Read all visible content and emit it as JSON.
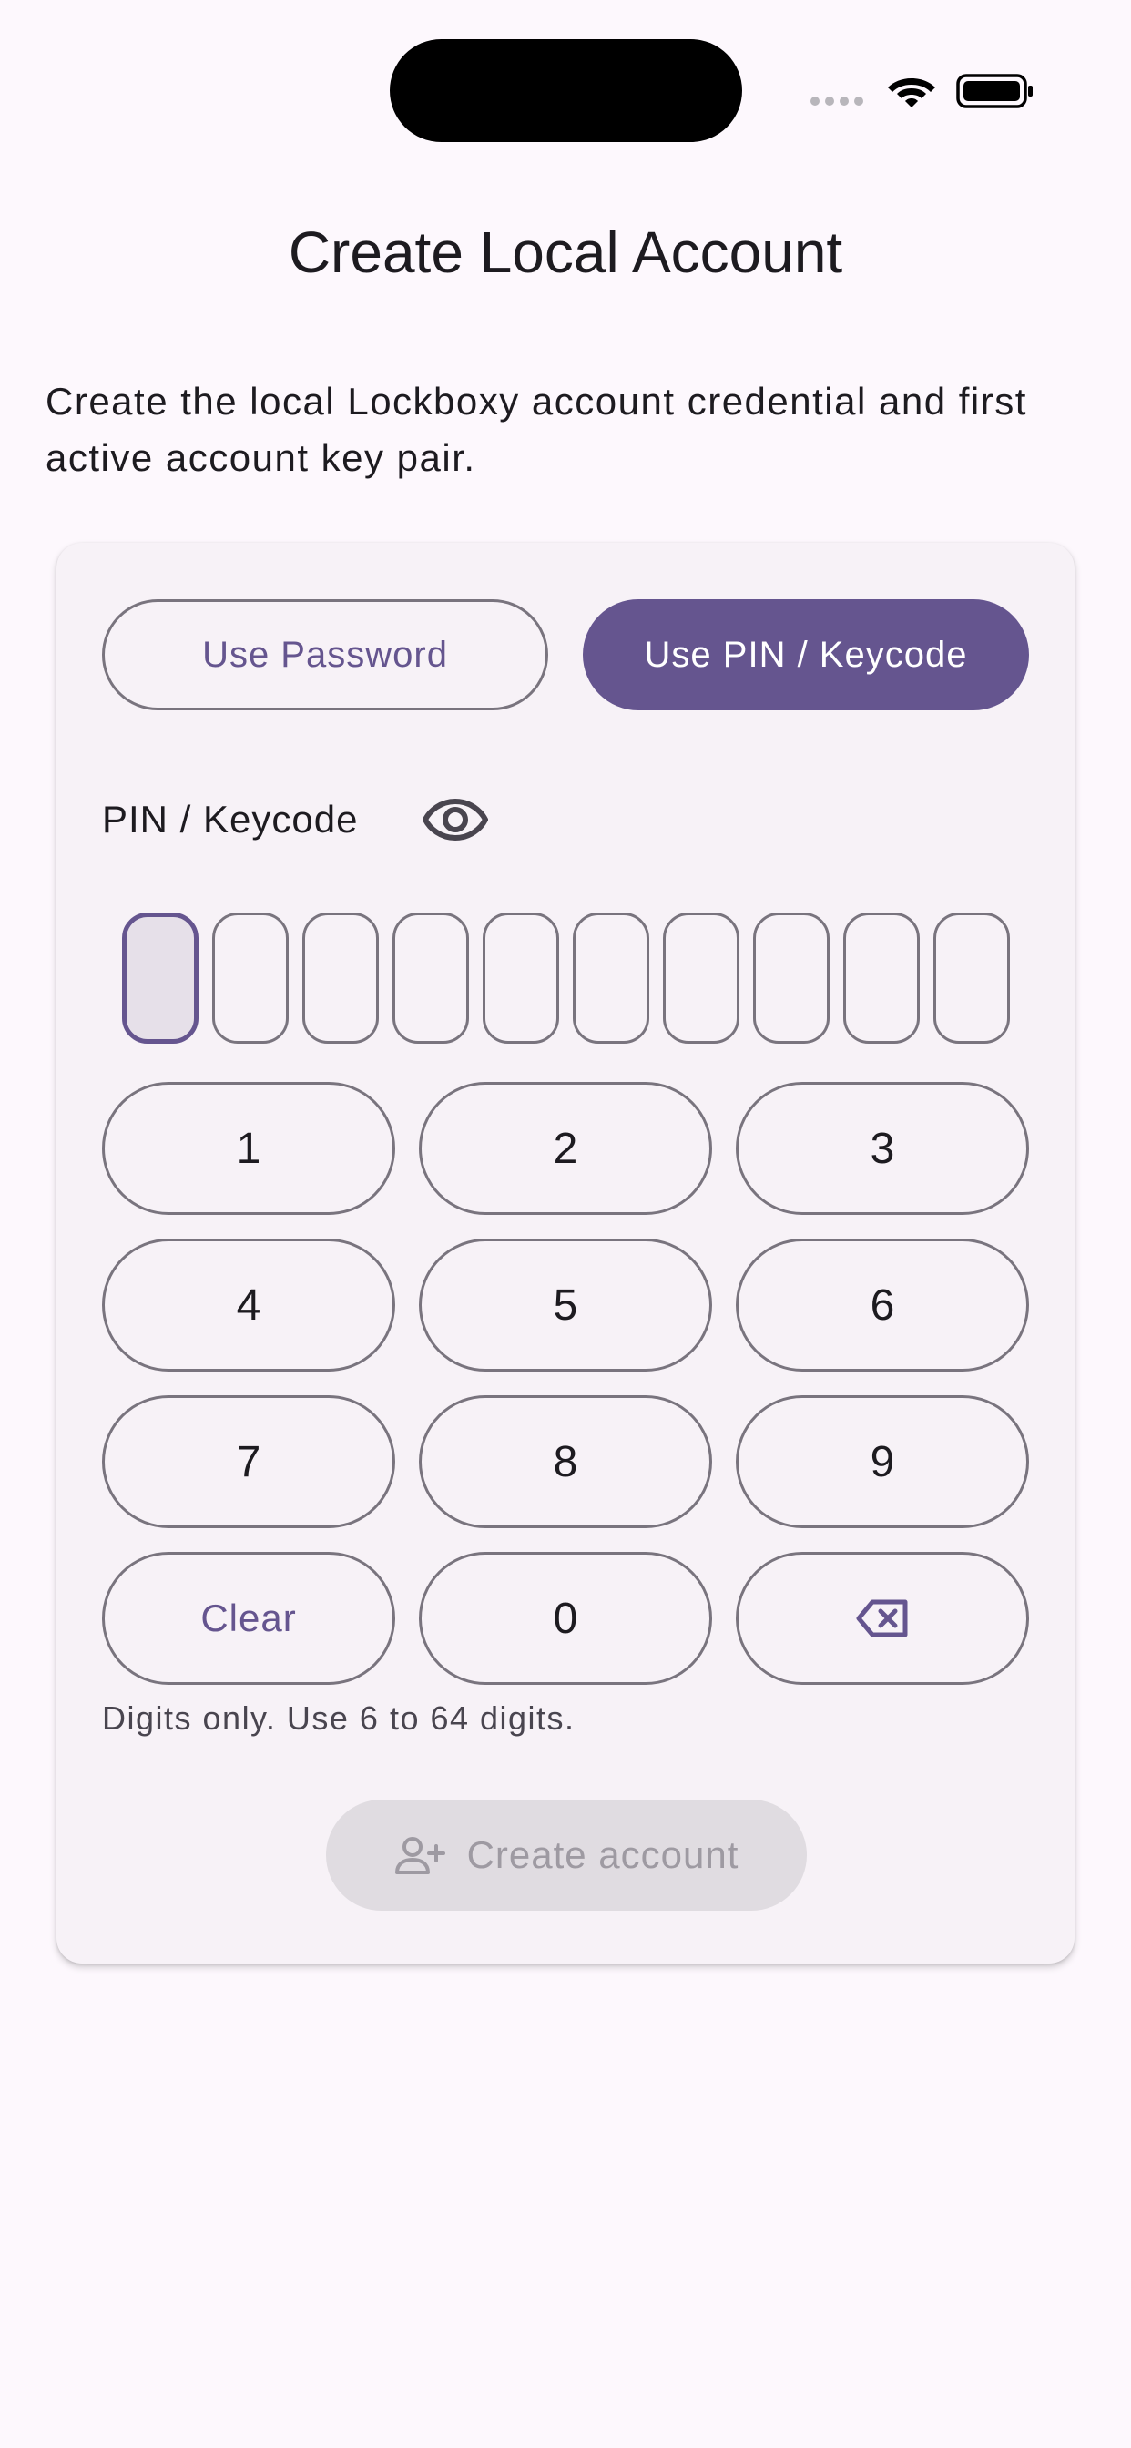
{
  "page": {
    "title": "Create Local Account",
    "intro": "Create the local Lockboxy account credential and first active account key pair."
  },
  "mode": {
    "password_label": "Use Password",
    "pin_label": "Use PIN / Keycode",
    "selected": "Use PIN / Keycode"
  },
  "pin": {
    "label": "PIN / Keycode",
    "toggle_icon": "eye-icon",
    "boxes": 10,
    "filled": 0,
    "active_index": 0
  },
  "keypad": {
    "k1": "1",
    "k2": "2",
    "k3": "3",
    "k4": "4",
    "k5": "5",
    "k6": "6",
    "k7": "7",
    "k8": "8",
    "k9": "9",
    "clear": "Clear",
    "k0": "0",
    "backspace_icon": "backspace-icon"
  },
  "hint": "Digits only. Use 6 to 64 digits.",
  "create": {
    "label": "Create account",
    "icon": "person-add-icon",
    "enabled": false
  },
  "colors": {
    "accent": "#65558f",
    "outline": "#79747e",
    "background": "#fdf8fd",
    "card": "#f7f2f7"
  }
}
